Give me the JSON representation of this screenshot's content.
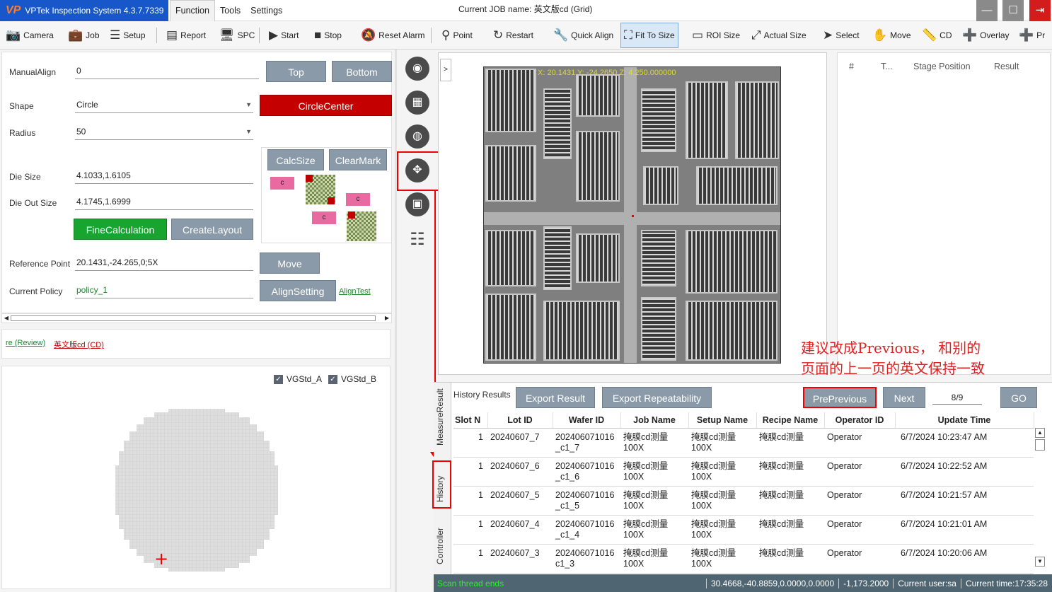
{
  "title": {
    "logo": "VP",
    "app_title": "VPTek Inspection System 4.3.7.7339",
    "menu": [
      "Function",
      "Tools",
      "Settings"
    ],
    "job_label": "Current JOB name:  英文版cd (Grid)"
  },
  "toolbar": {
    "camera": "Camera",
    "job": "Job",
    "setup": "Setup",
    "report": "Report",
    "spc": "SPC",
    "start": "Start",
    "stop": "Stop",
    "reset_alarm": "Reset Alarm",
    "point": "Point",
    "restart": "Restart",
    "quick_align": "Quick Align",
    "fit_to_size": "Fit To Size",
    "roi_size": "ROI Size",
    "actual_size": "Actual Size",
    "select": "Select",
    "move": "Move",
    "cd": "CD",
    "overlay": "Overlay",
    "pr": "Pr"
  },
  "align": {
    "manual_align_label": "ManualAlign",
    "manual_align_value": "0",
    "shape_label": "Shape",
    "shape_value": "Circle",
    "radius_label": "Radius",
    "radius_value": "50",
    "die_size_label": "Die Size",
    "die_size_value": "4.1033,1.6105",
    "die_out_label": "Die Out Size",
    "die_out_value": "4.1745,1.6999",
    "ref_label": "Reference Point",
    "ref_value": "20.1431,-24.265,0;5X",
    "policy_label": "Current Policy",
    "policy_value": "policy_1",
    "top": "Top",
    "bottom": "Bottom",
    "circle_center": "CircleCenter",
    "calc_size": "CalcSize",
    "clear_mark": "ClearMark",
    "fine_calc": "FineCalculation",
    "create_layout": "CreateLayout",
    "move": "Move",
    "align_setting": "AlignSetting",
    "align_test": "AlignTest",
    "diagram_label": "c"
  },
  "links": {
    "review": "re (Review)",
    "cd": "英文版cd (CD)"
  },
  "wafer": {
    "vgstd_a": "VGStd_A",
    "vgstd_b": "VGStd_B",
    "marker": "+"
  },
  "image": {
    "coord": "X: 20.1431  Y: -24.2650 Z: 4.250.000000"
  },
  "results": {
    "cols": [
      "#",
      "T...",
      "Stage Position",
      "Result"
    ]
  },
  "annotation": {
    "line1": "建议改成Previous，  和别的",
    "line2": "页面的上一页的英文保持一致"
  },
  "history": {
    "tabs": [
      "MeasureResult",
      "History",
      "Controller"
    ],
    "label": "History Results",
    "export_result": "Export Result",
    "export_repeat": "Export Repeatability",
    "preprevious": "PrePrevious",
    "next": "Next",
    "page": "8/9",
    "go": "GO",
    "columns": [
      "Slot N",
      "Lot ID",
      "Wafer ID",
      "Job Name",
      "Setup Name",
      "Recipe Name",
      "Operator ID",
      "Update Time"
    ],
    "rows": [
      {
        "slot": "1",
        "lot": "20240607_7",
        "wafer1": "202406071016",
        "wafer2": "_c1_7",
        "job1": "掩膜cd测量",
        "job2": "100X",
        "setup1": "掩膜cd测量",
        "setup2": "100X",
        "recipe": "掩膜cd测量",
        "op": "Operator",
        "time": "6/7/2024 10:23:47 AM"
      },
      {
        "slot": "1",
        "lot": "20240607_6",
        "wafer1": "202406071016",
        "wafer2": "_c1_6",
        "job1": "掩膜cd测量",
        "job2": "100X",
        "setup1": "掩膜cd测量",
        "setup2": "100X",
        "recipe": "掩膜cd测量",
        "op": "Operator",
        "time": "6/7/2024 10:22:52 AM"
      },
      {
        "slot": "1",
        "lot": "20240607_5",
        "wafer1": "202406071016",
        "wafer2": "_c1_5",
        "job1": "掩膜cd测量",
        "job2": "100X",
        "setup1": "掩膜cd测量",
        "setup2": "100X",
        "recipe": "掩膜cd测量",
        "op": "Operator",
        "time": "6/7/2024 10:21:57 AM"
      },
      {
        "slot": "1",
        "lot": "20240607_4",
        "wafer1": "202406071016",
        "wafer2": "_c1_4",
        "job1": "掩膜cd测量",
        "job2": "100X",
        "setup1": "掩膜cd测量",
        "setup2": "100X",
        "recipe": "掩膜cd测量",
        "op": "Operator",
        "time": "6/7/2024 10:21:01 AM"
      },
      {
        "slot": "1",
        "lot": "20240607_3",
        "wafer1": "202406071016",
        "wafer2": "c1_3",
        "job1": "掩膜cd测量",
        "job2": "100X",
        "setup1": "掩膜cd测量",
        "setup2": "100X",
        "recipe": "掩膜cd测量",
        "op": "Operator",
        "time": "6/7/2024 10:20:06 AM"
      }
    ]
  },
  "status": {
    "message": "Scan thread ends",
    "position": "30.4668,-40.8859,0.0000,0.0000",
    "value": "-1,173.2000",
    "user": "Current user:sa",
    "time": "Current time:17:35:28"
  },
  "colors": {
    "title_blue": "#1757c9",
    "accent_red": "#c40000",
    "accent_green": "#17a530",
    "button_gray": "#8a9aa8",
    "status_bar": "#4f6672"
  }
}
